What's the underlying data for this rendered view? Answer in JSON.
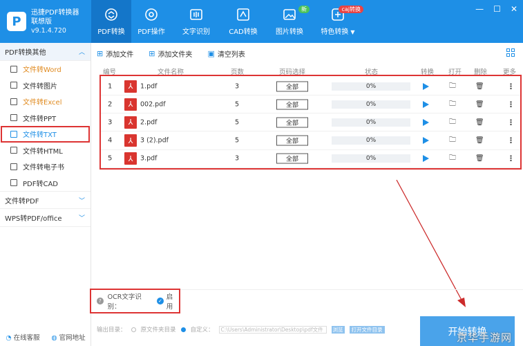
{
  "app": {
    "name_line1": "迅捷PDF转换器",
    "name_line2": "联想版",
    "version": "v9.1.4.720",
    "logo_letter": "P"
  },
  "nav": [
    {
      "label": "PDF转换",
      "icon": "refresh-doc-icon",
      "active": true
    },
    {
      "label": "PDF操作",
      "icon": "gear-doc-icon"
    },
    {
      "label": "文字识别",
      "icon": "ocr-icon"
    },
    {
      "label": "CAD转换",
      "icon": "cad-icon"
    },
    {
      "label": "图片转换",
      "icon": "image-icon",
      "badge": "新"
    },
    {
      "label": "特色转换",
      "icon": "special-icon",
      "badge": "caj转换",
      "caret": "▼"
    }
  ],
  "window_controls": [
    "—",
    "☐",
    "✕"
  ],
  "sidebar": {
    "group1": "PDF转换其他",
    "items": [
      {
        "label": "文件转Word",
        "style": "orange"
      },
      {
        "label": "文件转图片",
        "style": ""
      },
      {
        "label": "文件转Excel",
        "style": "orange"
      },
      {
        "label": "文件转PPT",
        "style": ""
      },
      {
        "label": "文件转TXT",
        "style": "selected"
      },
      {
        "label": "文件转HTML",
        "style": ""
      },
      {
        "label": "文件转电子书",
        "style": ""
      },
      {
        "label": "PDF转CAD",
        "style": ""
      }
    ],
    "group2": "文件转PDF",
    "group3": "WPS转PDF/office",
    "bottom_service": "在线客服",
    "bottom_site": "官网地址"
  },
  "toolbar": {
    "add_file": "添加文件",
    "add_folder": "添加文件夹",
    "clear_list": "清空列表"
  },
  "table": {
    "headers": {
      "index": "编号",
      "filename": "文件名称",
      "pages": "页数",
      "range": "页码选择",
      "status": "状态",
      "convert": "转换",
      "open": "打开",
      "delete": "删除",
      "more": "更多"
    },
    "rows": [
      {
        "index": "1",
        "name": "1.pdf",
        "pages": "3",
        "range": "全部",
        "progress": "0%"
      },
      {
        "index": "2",
        "name": "002.pdf",
        "pages": "5",
        "range": "全部",
        "progress": "0%"
      },
      {
        "index": "3",
        "name": "2.pdf",
        "pages": "5",
        "range": "全部",
        "progress": "0%"
      },
      {
        "index": "4",
        "name": "3 (2).pdf",
        "pages": "5",
        "range": "全部",
        "progress": "0%"
      },
      {
        "index": "5",
        "name": "3.pdf",
        "pages": "3",
        "range": "全部",
        "progress": "0%"
      }
    ]
  },
  "ocr": {
    "label": "OCR文字识别：",
    "value": "启用"
  },
  "output": {
    "label": "输出目录：",
    "option_source": "原文件夹目录",
    "option_custom": "自定义：",
    "path": "C:\\Users\\Administrator\\Desktop\\pdf文件",
    "browse": "浏览",
    "open_dir": "打开文件目录"
  },
  "start_button": "开始转换",
  "watermark": "京华手游网",
  "colors": {
    "brand": "#1e8fe6",
    "annotation": "#dd3333",
    "pdf_icon": "#d9352f"
  }
}
